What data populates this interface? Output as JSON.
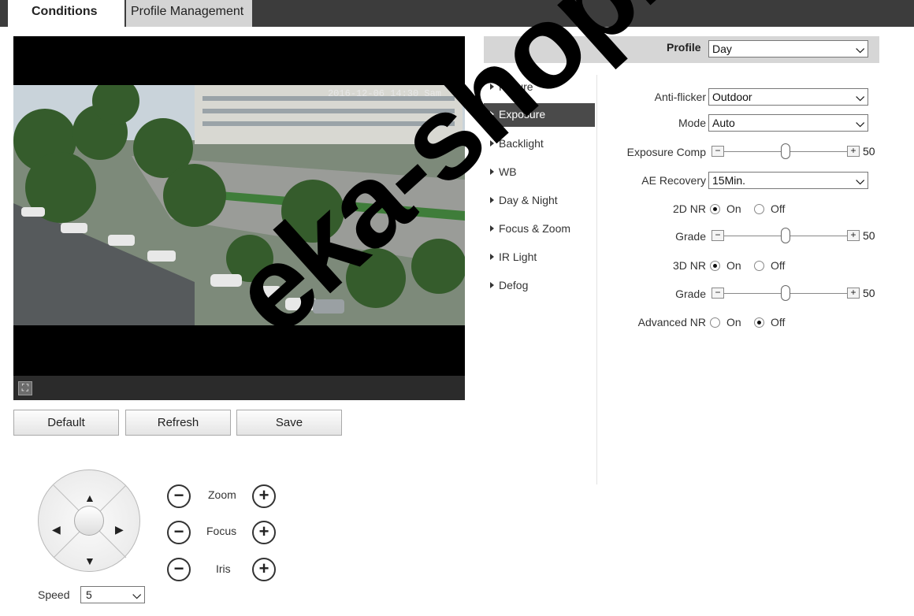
{
  "tabs": [
    {
      "label": "Conditions",
      "active": true
    },
    {
      "label": "Profile Management",
      "active": false
    }
  ],
  "video": {
    "osd_time": "2016-12-06 14:30 Sam"
  },
  "buttons": {
    "default": "Default",
    "refresh": "Refresh",
    "save": "Save"
  },
  "ptz": {
    "zoom_label": "Zoom",
    "focus_label": "Focus",
    "iris_label": "Iris",
    "speed_label": "Speed",
    "speed_value": "5",
    "minus": "−",
    "plus": "+"
  },
  "profile": {
    "label": "Profile",
    "value": "Day"
  },
  "menu": [
    {
      "label": "Picture",
      "active": false
    },
    {
      "label": "Exposure",
      "active": true
    },
    {
      "label": "Backlight",
      "active": false
    },
    {
      "label": "WB",
      "active": false
    },
    {
      "label": "Day & Night",
      "active": false
    },
    {
      "label": "Focus & Zoom",
      "active": false
    },
    {
      "label": "IR Light",
      "active": false
    },
    {
      "label": "Defog",
      "active": false
    }
  ],
  "settings": {
    "anti_flicker": {
      "label": "Anti-flicker",
      "value": "Outdoor"
    },
    "mode": {
      "label": "Mode",
      "value": "Auto"
    },
    "exposure_comp": {
      "label": "Exposure Comp",
      "value": "50",
      "fraction": 0.5
    },
    "ae_recovery": {
      "label": "AE Recovery",
      "value": "15Min."
    },
    "nr2d": {
      "label": "2D NR",
      "on": "On",
      "off": "Off",
      "selected": "On"
    },
    "grade1": {
      "label": "Grade",
      "value": "50",
      "fraction": 0.5
    },
    "nr3d": {
      "label": "3D NR",
      "on": "On",
      "off": "Off",
      "selected": "On"
    },
    "grade2": {
      "label": "Grade",
      "value": "50",
      "fraction": 0.5
    },
    "advanced_nr": {
      "label": "Advanced NR",
      "on": "On",
      "off": "Off",
      "selected": "Off"
    }
  },
  "watermark": "eka-shop.com"
}
